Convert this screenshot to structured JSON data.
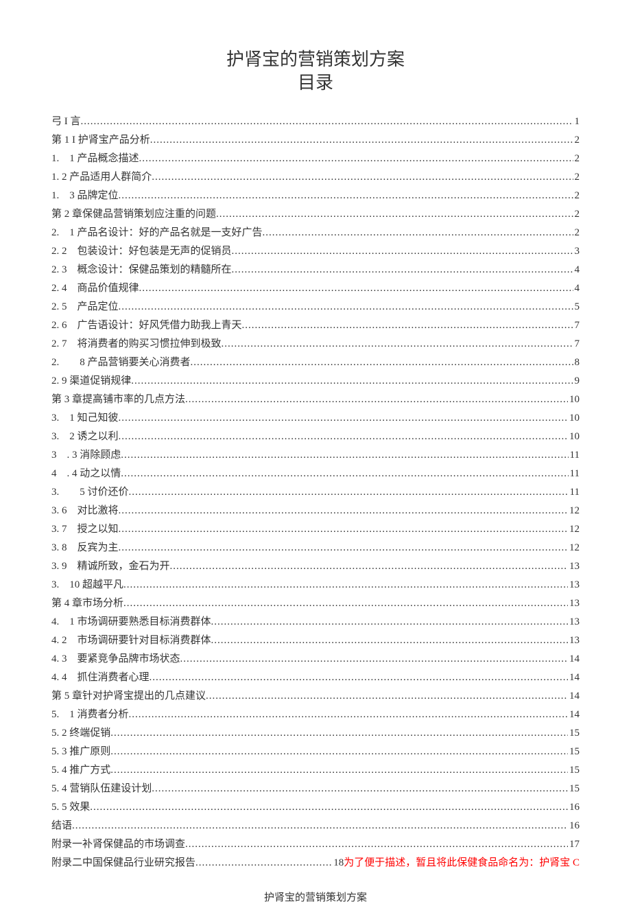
{
  "title": "护肾宝的营销策划方案",
  "subtitle": "目录",
  "footer_title": "护肾宝的营销策划方案",
  "appendix2_inline_note": "为了便于描述，暂且将此保健食品命名为：护肾宝 C",
  "toc": [
    {
      "label": "弓 I 言",
      "page": "1"
    },
    {
      "label": "第 1 I 护肾宝产品分析",
      "page": "2"
    },
    {
      "label": "1.　1 产品概念描述",
      "page": "2"
    },
    {
      "label": "1. 2 产品适用人群简介",
      "page": "2"
    },
    {
      "label": "1.　3 品牌定位",
      "page": "2"
    },
    {
      "label": "第 2 章保健品营销策划应注重的问题",
      "page": "2"
    },
    {
      "label": "2.　1 产品名设计：好的产品名就是一支好广告",
      "page": "2"
    },
    {
      "label": "2. 2　包装设计：好包装是无声的促销员",
      "page": "3"
    },
    {
      "label": "2. 3　概念设计：保健品策划的精髓所在",
      "page": "4"
    },
    {
      "label": "2. 4　商品价值规律",
      "page": "4"
    },
    {
      "label": "2. 5　产品定位",
      "page": "5"
    },
    {
      "label": "2. 6　广告语设计：好风凭借力助我上青天",
      "page": "7"
    },
    {
      "label": "2. 7　将消费者的购买习惯拉伸到极致",
      "page": "7"
    },
    {
      "label": "2.　　8 产品营销要关心消费者",
      "page": "8"
    },
    {
      "label": "2. 9 渠道促销规律",
      "page": "9"
    },
    {
      "label": "第 3 章提高铺市率的几点方法",
      "page": "10"
    },
    {
      "label": "3.　1 知己知彼",
      "page": "10"
    },
    {
      "label": "3.　2 诱之以利",
      "page": "10"
    },
    {
      "label": "3　. 3 消除顾虑",
      "page": "11"
    },
    {
      "label": "4　. 4 动之以情",
      "page": "11"
    },
    {
      "label": "3.　　5 讨价还价",
      "page": "11"
    },
    {
      "label": "3. 6　对比激将",
      "page": "12"
    },
    {
      "label": "3. 7　授之以知",
      "page": "12"
    },
    {
      "label": "3. 8　反宾为主",
      "page": "12"
    },
    {
      "label": "3. 9　精诚所致，金石为开",
      "page": "13"
    },
    {
      "label": "3.　10 超越平凡",
      "page": "13"
    },
    {
      "label": "第 4 章市场分析",
      "page": "13"
    },
    {
      "label": "4.　1 市场调研要熟悉目标消费群体",
      "page": "13"
    },
    {
      "label": "4. 2　市场调研要针对目标消费群体",
      "page": "13"
    },
    {
      "label": "4. 3　要紧竞争品牌市场状态",
      "page": "14"
    },
    {
      "label": "4. 4　抓住消费者心理",
      "page": "14"
    },
    {
      "label": "第 5 章针对护肾宝提出的几点建议",
      "page": "14"
    },
    {
      "label": "5.　1 消费者分析",
      "page": "14"
    },
    {
      "label": "5. 2 终端促销",
      "page": "15"
    },
    {
      "label": "5. 3 推广原则",
      "page": "15"
    },
    {
      "label": "5. 4 推广方式",
      "page": "15"
    },
    {
      "label": "5. 4 营销队伍建设计划",
      "page": "15"
    },
    {
      "label": "5. 5 效果",
      "page": "16"
    },
    {
      "label": "结语",
      "page": "16"
    },
    {
      "label": "附录一补肾保健品的市场调查",
      "page": "17"
    },
    {
      "label": "附录二中国保健品行业研究报告",
      "page": "18",
      "note_key": "appendix2_inline_note"
    }
  ]
}
